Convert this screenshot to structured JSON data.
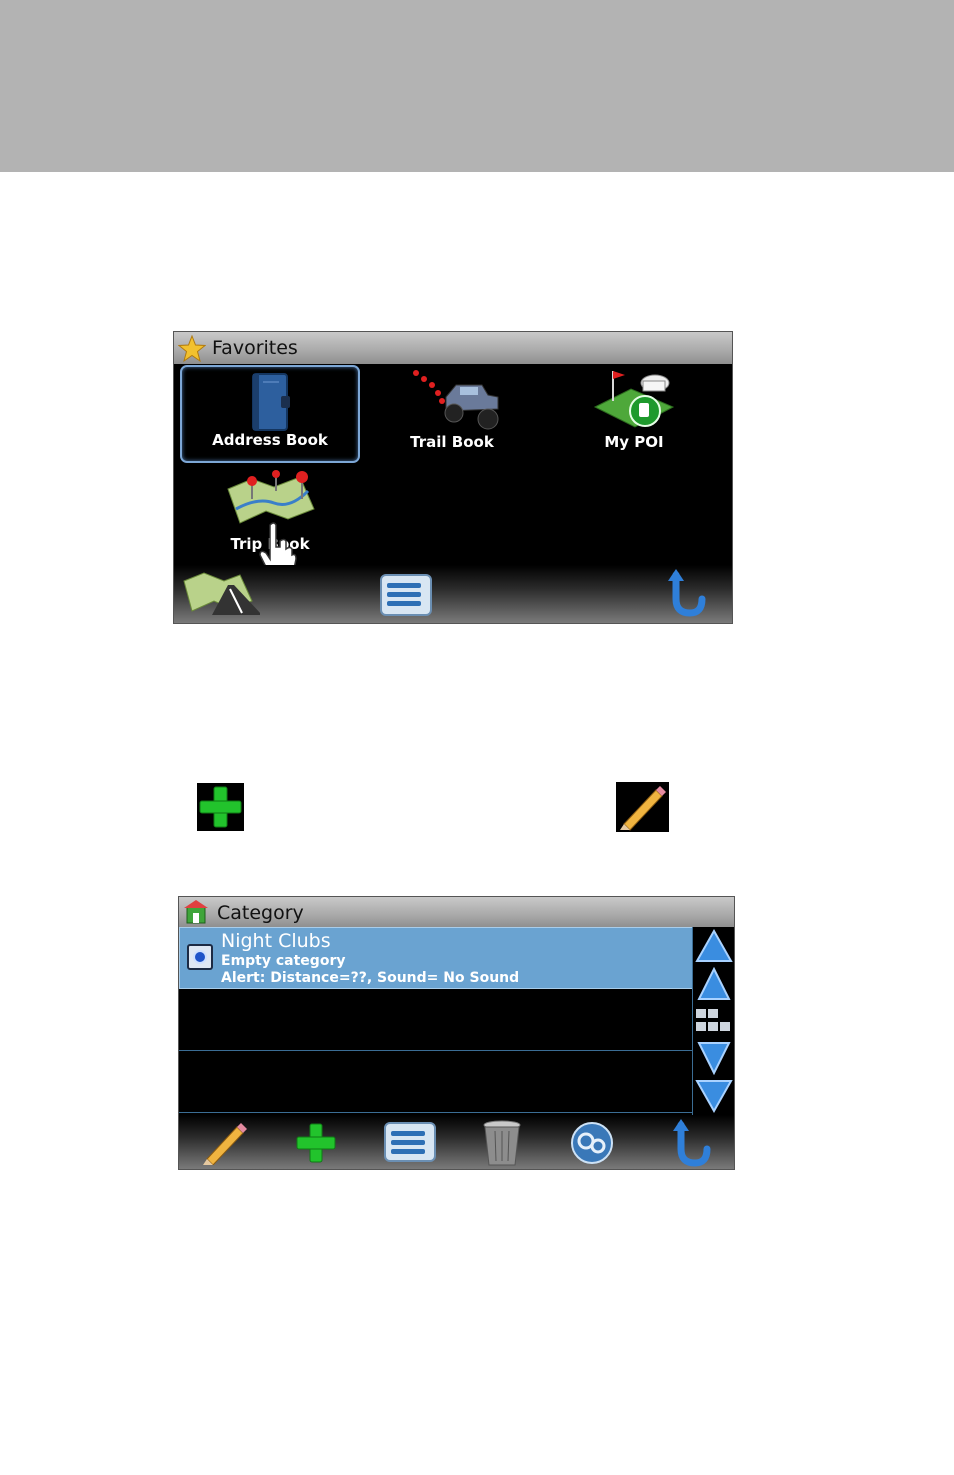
{
  "favorites": {
    "title": "Favorites",
    "tiles": [
      {
        "label": "Address Book"
      },
      {
        "label": "Trail Book"
      },
      {
        "label": "My POI"
      },
      {
        "label": "Trip Book"
      }
    ]
  },
  "category": {
    "title": "Category",
    "rows": [
      {
        "name": "Night Clubs",
        "detail1": "Empty category",
        "detail2": "Alert: Distance=??,  Sound= No Sound"
      }
    ]
  }
}
